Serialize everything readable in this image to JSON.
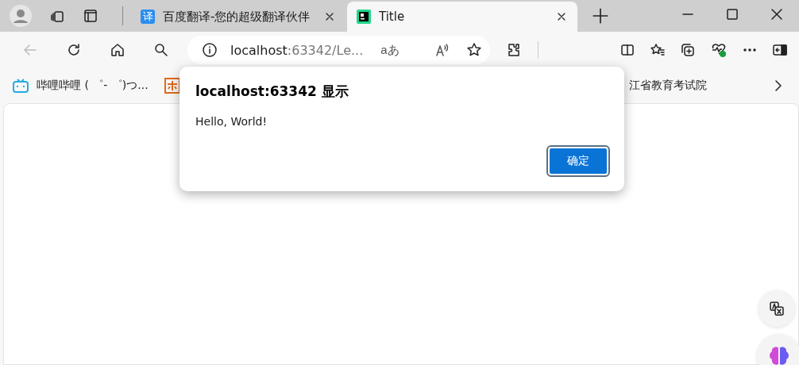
{
  "tabs": [
    {
      "title": "百度翻译-您的超级翻译伙伴",
      "favicon": "译",
      "kind": "translate",
      "selected": false
    },
    {
      "title": "Title",
      "kind": "ide",
      "selected": true
    }
  ],
  "toolbar": {
    "back_disabled": true
  },
  "address": {
    "host": "localhost",
    "rest": ":63342/Le...",
    "reader_label": "aあ"
  },
  "bookmarks": [
    {
      "kind": "bilibili",
      "label": "哔哩哔哩 ( ゜- ゜)つ..."
    },
    {
      "kind": "orange"
    }
  ],
  "partial_bookmark": {
    "label": "江省教育考试院"
  },
  "dialog": {
    "title": "localhost:63342 显示",
    "message": "Hello, World!",
    "button": "确定"
  }
}
